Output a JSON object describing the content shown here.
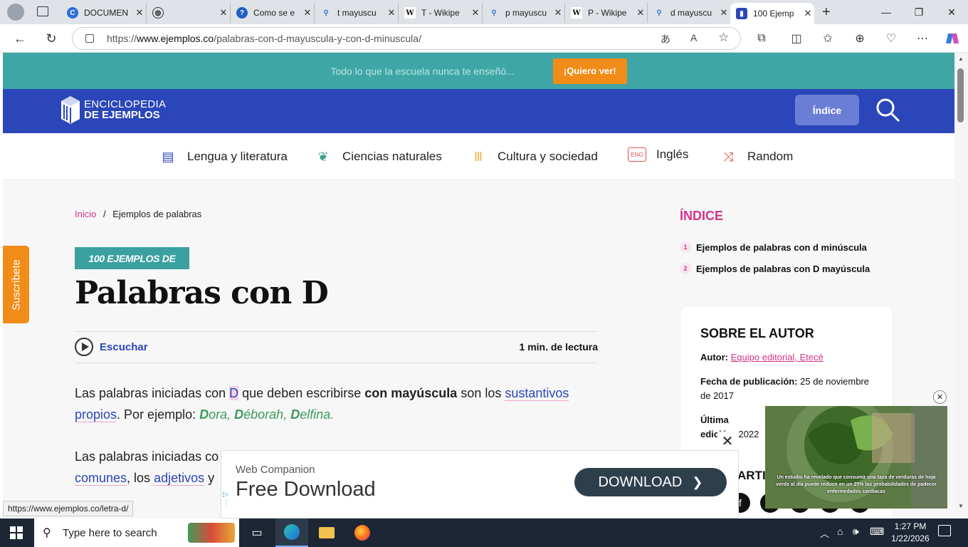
{
  "browser": {
    "tabs": [
      {
        "title": "DOCUMEN",
        "icon": "copilot-icon",
        "active": false
      },
      {
        "title": "",
        "icon": "globe-icon",
        "active": false
      },
      {
        "title": "Como se e",
        "icon": "help-icon",
        "active": false
      },
      {
        "title": "t mayuscu",
        "icon": "search-icon",
        "active": false
      },
      {
        "title": "T - Wikipe",
        "icon": "wikipedia-icon",
        "active": false
      },
      {
        "title": "p mayuscu",
        "icon": "search-icon",
        "active": false
      },
      {
        "title": "P - Wikipe",
        "icon": "wikipedia-icon",
        "active": false
      },
      {
        "title": "d mayuscu",
        "icon": "search-icon",
        "active": false
      },
      {
        "title": "100 Ejemp",
        "icon": "ejemplos-icon",
        "active": true
      }
    ],
    "url_prefix": "https://",
    "url_domain": "www.ejemplos.co",
    "url_path": "/palabras-con-d-mayuscula-y-con-d-minuscula/",
    "status_url": "https://www.ejemplos.co/letra-d/"
  },
  "promo": {
    "text": "Todo lo que la escuela nunca te enseñó...",
    "button": "¡Quiero ver!"
  },
  "header": {
    "logo_line1": "ENCICLOPEDIA",
    "logo_line2": "DE EJEMPLOS",
    "index_button": "Índice"
  },
  "categories": [
    {
      "label": "Lengua y literatura",
      "icon": "book-icon"
    },
    {
      "label": "Ciencias naturales",
      "icon": "plant-icon"
    },
    {
      "label": "Cultura y sociedad",
      "icon": "column-icon"
    },
    {
      "label": "Inglés",
      "icon": "eng-bubble-icon"
    },
    {
      "label": "Random",
      "icon": "shuffle-icon"
    }
  ],
  "breadcrumb": {
    "home": "Inicio",
    "sep": "/",
    "current": "Ejemplos de palabras"
  },
  "article": {
    "badge": "100 EJEMPLOS DE",
    "title": "Palabras con D",
    "listen": "Escuchar",
    "read_time": "1 min. de lectura",
    "p1": {
      "a": "Las palabras iniciadas con ",
      "hl": "D",
      "b": " que deben escribirse ",
      "bold": "con mayúscula",
      "c": " son los ",
      "link": "sustantivos propios",
      "d": ". Por ejemplo: ",
      "ex1": "D",
      "ex1r": "ora, ",
      "ex2": "D",
      "ex2r": "éborah, ",
      "ex3": "D",
      "ex3r": "elfina."
    },
    "p2": {
      "a": "Las palabras iniciadas co",
      "link1": "comunes",
      "b": ", los ",
      "link2": "adjetivos",
      "c": " y"
    }
  },
  "subscribe": "Suscríbete",
  "sidebar": {
    "index_title": "ÍNDICE",
    "items": [
      {
        "n": "1",
        "label": "Ejemplos de palabras con d minúscula"
      },
      {
        "n": "2",
        "label": "Ejemplos de palabras con D mayúscula"
      }
    ],
    "author_title": "SOBRE EL AUTOR",
    "author_label": "Autor:",
    "author_value": "Equipo editorial, Etecé",
    "pub_label": "Fecha de publicación:",
    "pub_value": "25 de noviembre de 2017",
    "edit_label": "Última edición:",
    "edit_value": "2022",
    "share_partial": "ARTI"
  },
  "ad": {
    "brand": "Web Companion",
    "headline": "Free Download",
    "button": "DOWNLOAD"
  },
  "video": {
    "caption": "Un estudio ha revelado que consumir una taza de verduras de hoja verde al día puede reducir en un 25% las probabilidades de padecer enfermedades cardíacas"
  },
  "taskbar": {
    "search_placeholder": "Type here to search",
    "time": "1:27 PM",
    "date": "1/22/2026"
  }
}
